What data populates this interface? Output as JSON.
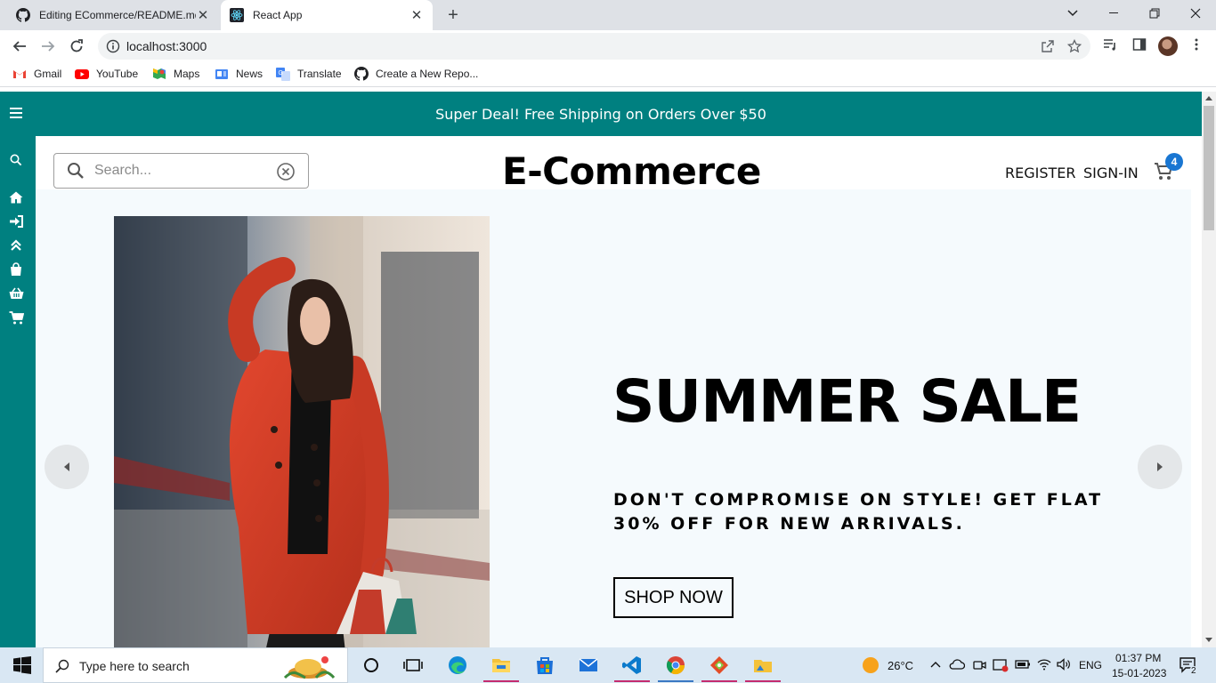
{
  "browser": {
    "tabs": [
      {
        "title": "Editing ECommerce/README.md",
        "icon": "github-icon",
        "active": false
      },
      {
        "title": "React App",
        "icon": "react-icon",
        "active": true
      }
    ],
    "url": "localhost:3000",
    "bookmarks": [
      {
        "label": "Gmail",
        "icon": "gmail-icon"
      },
      {
        "label": "YouTube",
        "icon": "youtube-icon"
      },
      {
        "label": "Maps",
        "icon": "maps-icon"
      },
      {
        "label": "News",
        "icon": "news-icon"
      },
      {
        "label": "Translate",
        "icon": "translate-icon"
      },
      {
        "label": "Create a New Repo...",
        "icon": "github-icon"
      }
    ]
  },
  "site": {
    "announcement": "Super Deal! Free Shipping on Orders Over $50",
    "search_placeholder": "Search...",
    "logo": "E-Commerce",
    "nav": {
      "register": "REGISTER",
      "signin": "SIGN-IN"
    },
    "cart_count": "4",
    "sidebar_icons": [
      "menu-icon",
      "search-icon",
      "home-icon",
      "sign-in-icon",
      "chevrons-up-icon",
      "shopping-bag-icon",
      "basket-icon",
      "cart-icon"
    ],
    "hero": {
      "title": "SUMMER SALE",
      "description": "DON'T COMPROMISE ON STYLE! GET FLAT 30% OFF FOR NEW ARRIVALS.",
      "button": "SHOP NOW"
    }
  },
  "taskbar": {
    "search_placeholder": "Type here to search",
    "weather": "26°C",
    "language": "ENG",
    "time": "01:37 PM",
    "date": "15-01-2023",
    "notifications": "2"
  },
  "colors": {
    "brand": "#008080",
    "badge": "#1976d2"
  }
}
